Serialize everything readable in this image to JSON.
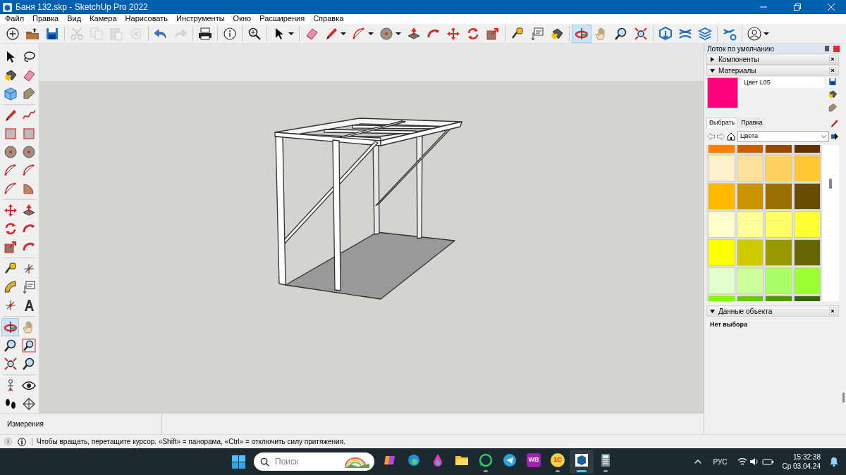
{
  "window": {
    "title": "Баня 132.skp - SketchUp Pro 2022"
  },
  "menu": [
    "Файл",
    "Правка",
    "Вид",
    "Камера",
    "Нарисовать",
    "Инструменты",
    "Окно",
    "Расширения",
    "Справка"
  ],
  "top_toolbar": [
    [
      {
        "kind": "new",
        "disabled": false,
        "selected": false
      },
      {
        "kind": "open",
        "disabled": false,
        "selected": false
      },
      {
        "kind": "save",
        "disabled": false,
        "selected": false
      }
    ],
    [
      {
        "kind": "cut",
        "disabled": true,
        "selected": false
      },
      {
        "kind": "copy",
        "disabled": true,
        "selected": false
      },
      {
        "kind": "paste",
        "disabled": true,
        "selected": false
      },
      {
        "kind": "delete",
        "disabled": true,
        "selected": false
      }
    ],
    [
      {
        "kind": "undo",
        "disabled": false,
        "selected": false
      },
      {
        "kind": "redo",
        "disabled": true,
        "selected": false
      }
    ],
    [
      {
        "kind": "print",
        "disabled": false,
        "selected": false
      }
    ],
    [
      {
        "kind": "info",
        "disabled": false,
        "selected": false
      }
    ],
    [
      {
        "kind": "zoomext",
        "disabled": false,
        "selected": false
      }
    ],
    [
      {
        "kind": "select",
        "disabled": false,
        "selected": false,
        "menu": true
      }
    ],
    [
      {
        "kind": "eraser",
        "disabled": false,
        "selected": false
      },
      {
        "kind": "pencil",
        "disabled": false,
        "selected": false,
        "menu": true
      },
      {
        "kind": "arc",
        "disabled": false,
        "selected": false,
        "menu": true
      },
      {
        "kind": "circle",
        "disabled": false,
        "selected": false,
        "menu": true
      },
      {
        "kind": "pushpull",
        "disabled": false,
        "selected": false
      },
      {
        "kind": "followme",
        "disabled": false,
        "selected": false
      },
      {
        "kind": "move",
        "disabled": false,
        "selected": false
      },
      {
        "kind": "rotate",
        "disabled": false,
        "selected": false
      },
      {
        "kind": "scale",
        "disabled": false,
        "selected": false
      }
    ],
    [
      {
        "kind": "tape",
        "disabled": false,
        "selected": false
      },
      {
        "kind": "text",
        "disabled": false,
        "selected": false
      },
      {
        "kind": "paint",
        "disabled": false,
        "selected": false
      }
    ],
    [
      {
        "kind": "orbit",
        "disabled": false,
        "selected": true
      },
      {
        "kind": "pan",
        "disabled": false,
        "selected": false
      },
      {
        "kind": "zoom",
        "disabled": false,
        "selected": false
      },
      {
        "kind": "zoomfit",
        "disabled": false,
        "selected": false
      }
    ],
    [
      {
        "kind": "warehouse",
        "disabled": false,
        "selected": false
      },
      {
        "kind": "waves",
        "disabled": false,
        "selected": false
      },
      {
        "kind": "layers",
        "disabled": false,
        "selected": false
      }
    ],
    [
      {
        "kind": "wavesgear",
        "disabled": false,
        "selected": false
      }
    ],
    [
      {
        "kind": "user",
        "disabled": false,
        "selected": false,
        "menu": true
      }
    ]
  ],
  "left_toolbar": [
    [
      {
        "kind": "select",
        "selected": false
      },
      {
        "kind": "lasso",
        "selected": false
      },
      {
        "kind": "paint",
        "selected": false
      },
      {
        "kind": "eraser",
        "selected": false
      },
      {
        "kind": "component",
        "selected": false
      },
      {
        "kind": "tag",
        "selected": false
      }
    ],
    [
      {
        "kind": "pencil",
        "selected": false
      },
      {
        "kind": "freehand",
        "selected": false
      },
      {
        "kind": "rect",
        "selected": false
      },
      {
        "kind": "rect",
        "selected": false
      },
      {
        "kind": "circle",
        "selected": false
      },
      {
        "kind": "circle",
        "selected": false
      },
      {
        "kind": "arc",
        "selected": false
      },
      {
        "kind": "arc",
        "selected": false
      },
      {
        "kind": "arc",
        "selected": false
      },
      {
        "kind": "pie",
        "selected": false
      }
    ],
    [
      {
        "kind": "move",
        "selected": false
      },
      {
        "kind": "pushpull",
        "selected": false
      },
      {
        "kind": "rotate",
        "selected": false
      },
      {
        "kind": "followme",
        "selected": false
      },
      {
        "kind": "scale",
        "selected": false
      },
      {
        "kind": "followme",
        "selected": false
      }
    ],
    [
      {
        "kind": "tape",
        "selected": false
      },
      {
        "kind": "axes",
        "selected": false
      },
      {
        "kind": "protractor",
        "selected": false
      },
      {
        "kind": "text",
        "selected": false
      },
      {
        "kind": "axes",
        "selected": false
      },
      {
        "kind": "text3d",
        "selected": false
      }
    ],
    [
      {
        "kind": "orbit",
        "selected": true
      },
      {
        "kind": "pan",
        "selected": false
      },
      {
        "kind": "zoom",
        "selected": false
      },
      {
        "kind": "zoomwin",
        "selected": false
      },
      {
        "kind": "zoomfit",
        "selected": false
      },
      {
        "kind": "zoom",
        "selected": false
      }
    ],
    [
      {
        "kind": "figure",
        "selected": false
      },
      {
        "kind": "eye",
        "selected": false
      },
      {
        "kind": "footprints",
        "selected": false
      },
      {
        "kind": "section",
        "selected": false
      }
    ]
  ],
  "tray": {
    "title": "Лоток по умолчанию",
    "components": {
      "title": "Компоненты",
      "expanded": false
    },
    "materials": {
      "title": "Материалы",
      "expanded": true,
      "current": {
        "name": "Цвет L05",
        "color": "#ff0080"
      },
      "tabs": [
        {
          "label": "Выбрать",
          "selected": true
        },
        {
          "label": "Правка",
          "selected": false
        }
      ],
      "library": "Цвета",
      "swatches": [
        {
          "color": "#ff8000"
        },
        {
          "color": "#cc6000"
        },
        {
          "color": "#994800"
        },
        {
          "color": "#603000"
        },
        {
          "color": "#fff0cc"
        },
        {
          "color": "#ffe099"
        },
        {
          "color": "#ffd060"
        },
        {
          "color": "#ffc833"
        },
        {
          "color": "#ffb800"
        },
        {
          "color": "#cc9400"
        },
        {
          "color": "#997000"
        },
        {
          "color": "#664c00"
        },
        {
          "color": "#ffffcc"
        },
        {
          "color": "#ffff99"
        },
        {
          "color": "#ffff66"
        },
        {
          "color": "#ffff33"
        },
        {
          "color": "#ffff00"
        },
        {
          "color": "#cccc00"
        },
        {
          "color": "#999900"
        },
        {
          "color": "#666600"
        },
        {
          "color": "#e0ffcc"
        },
        {
          "color": "#ccff99"
        },
        {
          "color": "#aaff66"
        },
        {
          "color": "#99ff33"
        },
        {
          "color": "#80ff00"
        },
        {
          "color": "#66cc00"
        },
        {
          "color": "#4d9900"
        },
        {
          "color": "#336600"
        }
      ]
    },
    "entity_info": {
      "title": "Данные объекта",
      "expanded": true,
      "text": "Нет выбора"
    }
  },
  "measurements": {
    "label": "Измерения"
  },
  "status_bar": {
    "text": "Чтобы вращать, перетащите курсор. «Shift» = панорама, «Ctrl» = отключить силу притяжения."
  },
  "taskbar": {
    "search_placeholder": "Поиск",
    "apps": [
      {
        "kind": "copilot",
        "running": false,
        "selected": false
      },
      {
        "kind": "edge",
        "running": false,
        "selected": false
      },
      {
        "kind": "drop",
        "running": false,
        "selected": false
      },
      {
        "kind": "folder",
        "running": false,
        "selected": false
      },
      {
        "kind": "whatsapp",
        "running": true,
        "selected": false
      },
      {
        "kind": "telegram",
        "running": false,
        "selected": false
      },
      {
        "kind": "wb",
        "label": "WB",
        "running": false,
        "selected": false
      },
      {
        "kind": "onec",
        "label": "1С",
        "running": true,
        "selected": false
      },
      {
        "kind": "sketchup",
        "running": true,
        "selected": true
      },
      {
        "kind": "calc",
        "running": true,
        "selected": false
      }
    ],
    "language": "РУС",
    "time": "15:32:38",
    "date": "Ср 03.04.24"
  }
}
